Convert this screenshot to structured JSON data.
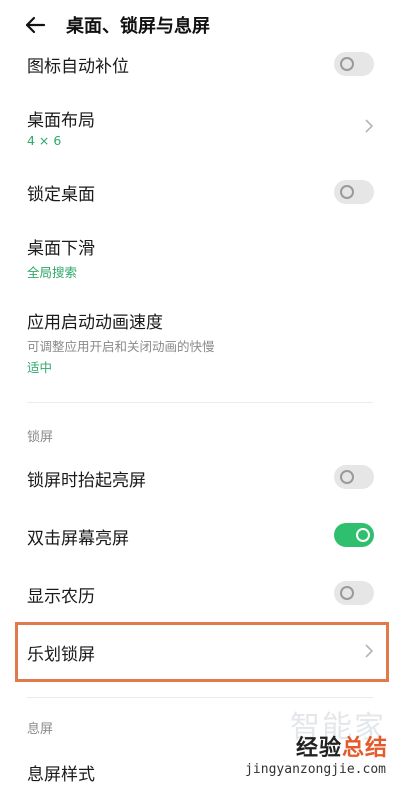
{
  "header": {
    "title": "桌面、锁屏与息屏"
  },
  "items": {
    "icon_autofill": {
      "label": "图标自动补位",
      "on": false
    },
    "desktop_layout": {
      "label": "桌面布局",
      "value": "4 × 6"
    },
    "lock_desktop": {
      "label": "锁定桌面",
      "on": false
    },
    "swipe_down": {
      "label": "桌面下滑",
      "value": "全局搜索"
    },
    "anim_speed": {
      "label": "应用启动动画速度",
      "desc": "可调整应用开启和关闭动画的快慢",
      "value": "适中"
    },
    "lift_to_wake": {
      "label": "锁屏时抬起亮屏",
      "on": false
    },
    "double_tap": {
      "label": "双击屏幕亮屏",
      "on": true
    },
    "lunar": {
      "label": "显示农历",
      "on": false
    },
    "lock_magazine": {
      "label": "乐划锁屏"
    },
    "screen_off_style": {
      "label": "息屏样式"
    }
  },
  "sections": {
    "lock": "锁屏",
    "screen_off": "息屏"
  },
  "watermark": {
    "ghost": "智能家",
    "brand_pre": "经验",
    "brand_accent": "总结",
    "url": "jingyanzongjie.com"
  },
  "colors": {
    "accent_green": "#2fbf6f",
    "value_green": "#2fa86a",
    "highlight": "#e07a4a"
  },
  "icons": {
    "back": "arrow-left-icon",
    "chevron": "chevron-right-icon"
  }
}
